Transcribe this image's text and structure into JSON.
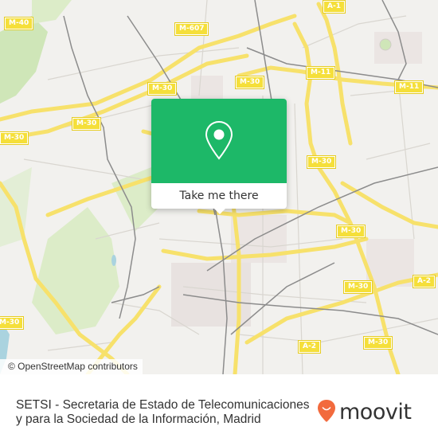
{
  "map": {
    "road_labels": [
      {
        "id": "m40-nw",
        "text": "M-40"
      },
      {
        "id": "m607",
        "text": "M-607"
      },
      {
        "id": "a1",
        "text": "A-1"
      },
      {
        "id": "m11-a",
        "text": "M-11"
      },
      {
        "id": "m11-b",
        "text": "M-11"
      },
      {
        "id": "m30-a",
        "text": "M-30"
      },
      {
        "id": "m30-b",
        "text": "M-30"
      },
      {
        "id": "m30-c",
        "text": "M-30"
      },
      {
        "id": "m30-d",
        "text": "M-30"
      },
      {
        "id": "m30-e",
        "text": "M-30"
      },
      {
        "id": "m30-f",
        "text": "M-30"
      },
      {
        "id": "m30-g",
        "text": "M-30"
      },
      {
        "id": "m30-h",
        "text": "M-30"
      },
      {
        "id": "m30-i",
        "text": "M-30"
      },
      {
        "id": "a2-a",
        "text": "A-2"
      },
      {
        "id": "a2-b",
        "text": "A-2"
      }
    ],
    "attribution": "© OpenStreetMap contributors"
  },
  "popup": {
    "icon": "map-pin-icon",
    "button_label": "Take me there",
    "accent_color": "#1db868"
  },
  "footer": {
    "title": "SETSI - Secretaria de Estado de Telecomunicaciones y para la Sociedad de la Información, Madrid",
    "logo_text": "moovit",
    "logo_color": "#f26a3d"
  }
}
